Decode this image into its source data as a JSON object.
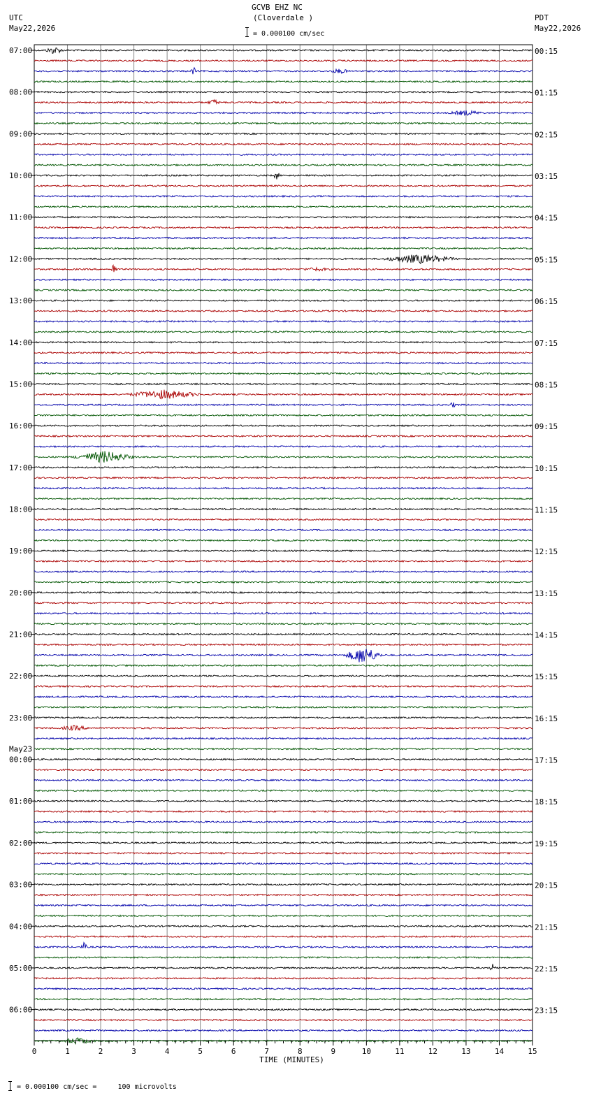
{
  "header": {
    "station": "GCVB EHZ NC",
    "location": "(Cloverdale )",
    "scale_text": "= 0.000100 cm/sec",
    "left_tz": "UTC",
    "left_date": "May22,2026",
    "right_tz": "PDT",
    "right_date": "May22,2026"
  },
  "footer": {
    "scale_note": "= 0.000100 cm/sec =     100 microvolts"
  },
  "colors": {
    "trace_cycle": [
      "#000000",
      "#aa0000",
      "#0000aa",
      "#005500"
    ],
    "grid": "#888888",
    "frame": "#000000"
  },
  "chart_data": {
    "type": "line",
    "title": "GCVB EHZ NC (Cloverdale )",
    "xlabel": "TIME (MINUTES)",
    "ylabel": "",
    "xlim": [
      0,
      15
    ],
    "x_ticks": [
      "0",
      "1",
      "2",
      "3",
      "4",
      "5",
      "6",
      "7",
      "8",
      "9",
      "10",
      "11",
      "12",
      "13",
      "14",
      "15"
    ],
    "trace_count": 96,
    "traces_per_hour": 4,
    "grid": true,
    "left_hour_labels": [
      "07:00",
      "08:00",
      "09:00",
      "10:00",
      "11:00",
      "12:00",
      "13:00",
      "14:00",
      "15:00",
      "16:00",
      "17:00",
      "18:00",
      "19:00",
      "20:00",
      "21:00",
      "22:00",
      "23:00",
      "00:00",
      "01:00",
      "02:00",
      "03:00",
      "04:00",
      "05:00",
      "06:00"
    ],
    "date_change_label": "May23",
    "date_change_hour_index": 17,
    "right_hour_labels": [
      "00:15",
      "01:15",
      "02:15",
      "03:15",
      "04:15",
      "05:15",
      "06:15",
      "07:15",
      "08:15",
      "09:15",
      "10:15",
      "11:15",
      "12:15",
      "13:15",
      "14:15",
      "15:15",
      "16:15",
      "17:15",
      "18:15",
      "19:15",
      "20:15",
      "21:15",
      "22:15",
      "23:15"
    ],
    "events": [
      {
        "trace": 0,
        "minute": 0.6,
        "duration": 0.3,
        "amplitude": 5
      },
      {
        "trace": 2,
        "minute": 4.8,
        "duration": 0.1,
        "amplitude": 5
      },
      {
        "trace": 2,
        "minute": 9.2,
        "duration": 0.3,
        "amplitude": 3
      },
      {
        "trace": 5,
        "minute": 5.4,
        "duration": 0.2,
        "amplitude": 4
      },
      {
        "trace": 6,
        "minute": 13.0,
        "duration": 0.6,
        "amplitude": 3
      },
      {
        "trace": 12,
        "minute": 7.3,
        "duration": 0.1,
        "amplitude": 6
      },
      {
        "trace": 20,
        "minute": 11.6,
        "duration": 1.2,
        "amplitude": 6
      },
      {
        "trace": 21,
        "minute": 2.4,
        "duration": 0.1,
        "amplitude": 9
      },
      {
        "trace": 21,
        "minute": 8.5,
        "duration": 0.5,
        "amplitude": 2
      },
      {
        "trace": 33,
        "minute": 3.9,
        "duration": 1.2,
        "amplitude": 6
      },
      {
        "trace": 34,
        "minute": 12.6,
        "duration": 0.1,
        "amplitude": 4
      },
      {
        "trace": 39,
        "minute": 2.1,
        "duration": 1.0,
        "amplitude": 8
      },
      {
        "trace": 58,
        "minute": 9.9,
        "duration": 0.6,
        "amplitude": 12
      },
      {
        "trace": 65,
        "minute": 1.2,
        "duration": 0.5,
        "amplitude": 3
      },
      {
        "trace": 86,
        "minute": 1.5,
        "duration": 0.1,
        "amplitude": 6
      },
      {
        "trace": 88,
        "minute": 13.8,
        "duration": 0.1,
        "amplitude": 5
      },
      {
        "trace": 95,
        "minute": 1.3,
        "duration": 0.6,
        "amplitude": 4
      }
    ]
  }
}
